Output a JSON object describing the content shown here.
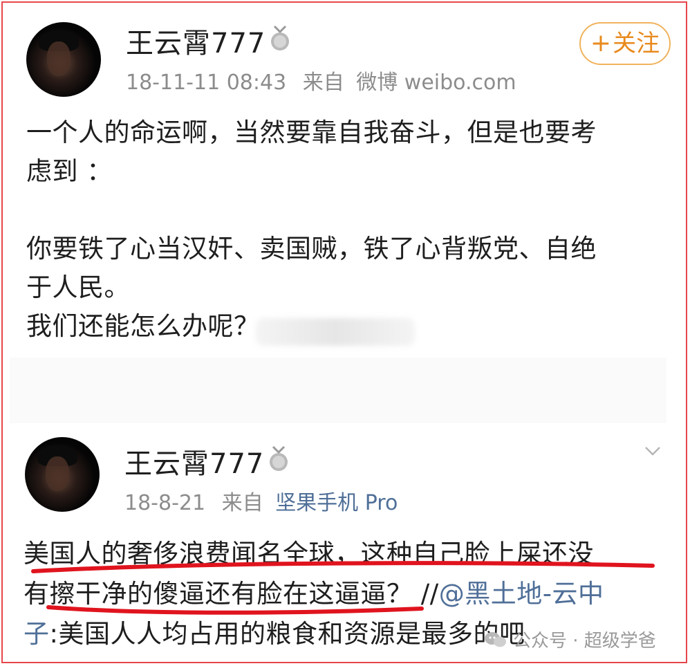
{
  "post1": {
    "username": "王云霄777",
    "timestamp": "18-11-11 08:43",
    "source_prefix": "来自",
    "source": "微博 weibo.com",
    "follow_label": "关注",
    "lines": [
      "一个人的命运啊，当然要靠自我奋斗，但是也要考",
      "虑到 ：",
      "",
      "你要铁了心当汉奸、卖国贼，铁了心背叛党、自绝",
      "于人民。",
      "我们还能怎么办呢？"
    ]
  },
  "post2": {
    "username": "王云霄777",
    "timestamp": "18-8-21",
    "source_prefix": "来自",
    "source": "坚果手机 Pro",
    "line1": "美国人的奢侈浪费闻名全球，这种自己脸上屎还没",
    "line2_text": "有擦干净的傻逼还有脸在这逼逼？ //",
    "line2_mention": "@黑土地-云中",
    "line3_mention": "子",
    "line3_text": ":美国人人均占用的粮食和资源是最多的吧"
  },
  "watermark": {
    "text": "公众号 · 超级学爸"
  },
  "colors": {
    "border": "#e6464b",
    "accent": "#e88a1d",
    "link": "#4f6f98",
    "underline": "#e0141e"
  }
}
